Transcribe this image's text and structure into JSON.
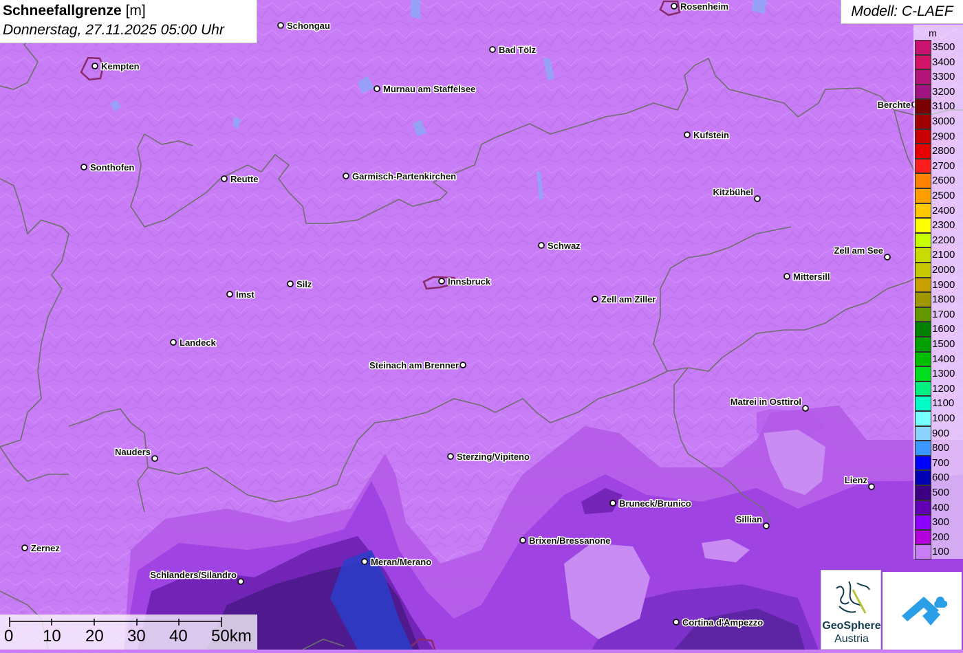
{
  "title": {
    "main": "Schneefallgrenze",
    "unit": "[m]",
    "datetime": "Donnerstag, 27.11.2025 05:00 Uhr"
  },
  "model": "Modell: C-LAEF",
  "legend": {
    "unit": "m",
    "entries": [
      {
        "label": "3500",
        "color": "#c8146e"
      },
      {
        "label": "3400",
        "color": "#d21469"
      },
      {
        "label": "3300",
        "color": "#b41478"
      },
      {
        "label": "3200",
        "color": "#a01482"
      },
      {
        "label": "3100",
        "color": "#780000"
      },
      {
        "label": "3000",
        "color": "#a00000"
      },
      {
        "label": "2900",
        "color": "#c80000"
      },
      {
        "label": "2800",
        "color": "#e60000"
      },
      {
        "label": "2700",
        "color": "#ff1e1e"
      },
      {
        "label": "2600",
        "color": "#ff8200"
      },
      {
        "label": "2500",
        "color": "#ffa000"
      },
      {
        "label": "2400",
        "color": "#ffc800"
      },
      {
        "label": "2300",
        "color": "#ffff00"
      },
      {
        "label": "2200",
        "color": "#c8ff00"
      },
      {
        "label": "2100",
        "color": "#c8dc00"
      },
      {
        "label": "2000",
        "color": "#c8c800"
      },
      {
        "label": "1900",
        "color": "#c8a000"
      },
      {
        "label": "1800",
        "color": "#a09600"
      },
      {
        "label": "1700",
        "color": "#649600"
      },
      {
        "label": "1600",
        "color": "#008200"
      },
      {
        "label": "1500",
        "color": "#00a000"
      },
      {
        "label": "1400",
        "color": "#00be00"
      },
      {
        "label": "1300",
        "color": "#00dc1e"
      },
      {
        "label": "1200",
        "color": "#00f082"
      },
      {
        "label": "1100",
        "color": "#00ffc8"
      },
      {
        "label": "1000",
        "color": "#78ffff"
      },
      {
        "label": "900",
        "color": "#8cd2ff"
      },
      {
        "label": "800",
        "color": "#3c96ff"
      },
      {
        "label": "700",
        "color": "#0000ff"
      },
      {
        "label": "600",
        "color": "#0000b4"
      },
      {
        "label": "500",
        "color": "#3c0082"
      },
      {
        "label": "400",
        "color": "#6400b4"
      },
      {
        "label": "300",
        "color": "#8c00ff"
      },
      {
        "label": "200",
        "color": "#b400dc"
      },
      {
        "label": "100",
        "color": "#c87df7"
      }
    ]
  },
  "cities": [
    {
      "name": "Rosenheim"
    },
    {
      "name": "Schongau"
    },
    {
      "name": "Bad Tölz"
    },
    {
      "name": "Kempten"
    },
    {
      "name": "Murnau am Staffelsee"
    },
    {
      "name": "Berchte"
    },
    {
      "name": "Kufstein"
    },
    {
      "name": "Sonthofen"
    },
    {
      "name": "Reutte"
    },
    {
      "name": "Garmisch-Partenkirchen"
    },
    {
      "name": "Kitzbühel"
    },
    {
      "name": "Schwaz"
    },
    {
      "name": "Zell am See"
    },
    {
      "name": "Mittersill"
    },
    {
      "name": "Silz"
    },
    {
      "name": "Innsbruck"
    },
    {
      "name": "Imst"
    },
    {
      "name": "Zell am Ziller"
    },
    {
      "name": "Landeck"
    },
    {
      "name": "Steinach am Brenner"
    },
    {
      "name": "Matrei in Osttirol"
    },
    {
      "name": "Nauders"
    },
    {
      "name": "Sterzing/Vipiteno"
    },
    {
      "name": "Lienz"
    },
    {
      "name": "Bruneck/Brunico"
    },
    {
      "name": "Sillian"
    },
    {
      "name": "Brixen/Bressanone"
    },
    {
      "name": "Zernez"
    },
    {
      "name": "Meran/Merano"
    },
    {
      "name": "Schlanders/Silandro"
    },
    {
      "name": "Cortina d'Ampezzo"
    }
  ],
  "scale": {
    "labels": [
      "0",
      "10",
      "20",
      "30",
      "40",
      "50km"
    ]
  },
  "logos": {
    "geosphere_line1": "GeoSphere",
    "geosphere_line2": "Austria"
  }
}
